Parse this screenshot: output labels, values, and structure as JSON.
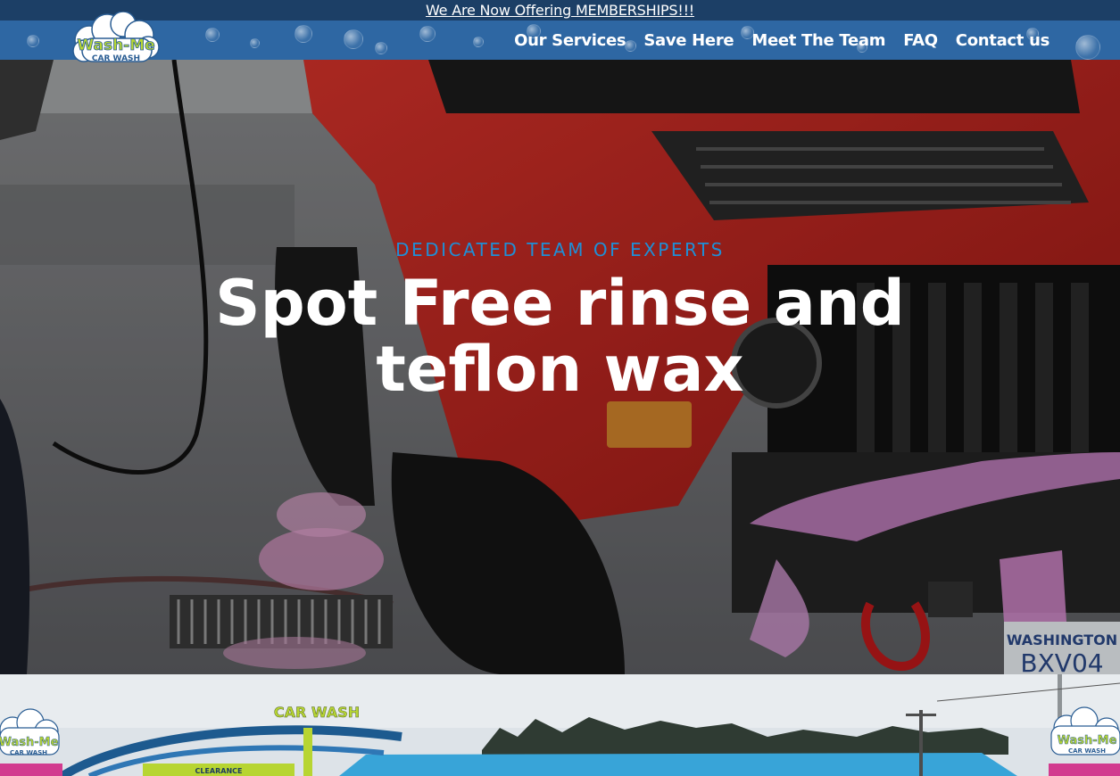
{
  "announcement": {
    "text": "We Are Now Offering MEMBERSHIPS!!!"
  },
  "brand": {
    "logo_line1": "Wash-Me",
    "logo_line2": "CAR WASH"
  },
  "nav": {
    "items": [
      {
        "label": "Our Services"
      },
      {
        "label": "Save Here"
      },
      {
        "label": "Meet The Team"
      },
      {
        "label": "FAQ"
      },
      {
        "label": "Contact us"
      }
    ]
  },
  "hero": {
    "eyebrow": "DEDICATED TEAM OF EXPERTS",
    "headline_line1": "Spot Free rinse and",
    "headline_line2": "teflon wax",
    "plate_state": "WASHINGTON",
    "plate_number": "BXV04"
  },
  "location_photo": {
    "sign_text": "CAR WASH",
    "canopy_text": "CLEARANCE",
    "logo_line1": "Wash-Me",
    "logo_line2": "CAR WASH"
  },
  "colors": {
    "announcement_bg": "#1c3f66",
    "nav_bg": "#2e67a3",
    "eyebrow": "#1f8fd6",
    "headline": "#ffffff"
  }
}
